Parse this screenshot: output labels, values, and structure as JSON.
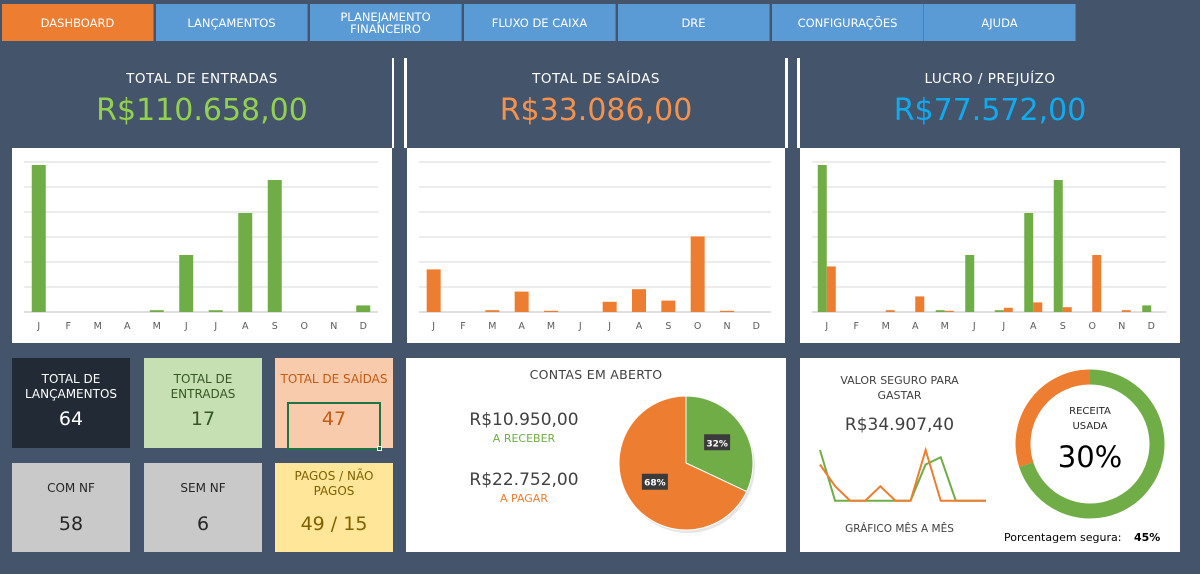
{
  "tabs": [
    {
      "label": "DASHBOARD",
      "active": true
    },
    {
      "label": "LANÇAMENTOS"
    },
    {
      "label": "PLANEJAMENTO FINANCEIRO"
    },
    {
      "label": "FLUXO DE CAIXA"
    },
    {
      "label": "DRE"
    },
    {
      "label": "CONFIGURAÇÕES"
    },
    {
      "label": "AJUDA"
    }
  ],
  "entradas": {
    "title": "TOTAL DE ENTRADAS",
    "value": "R$110.658,00",
    "color": "#92d050"
  },
  "saidas": {
    "title": "TOTAL DE SAÍDAS",
    "value": "R$33.086,00",
    "color": "#ed7d31"
  },
  "lucro": {
    "title": "LUCRO / PREJUÍZO",
    "value": "R$77.572,00",
    "color": "#00b0f0"
  },
  "kpis": {
    "lancamentos": {
      "title": "TOTAL DE LANÇAMENTOS",
      "value": "64"
    },
    "entradas": {
      "title": "TOTAL DE ENTRADAS",
      "value": "17"
    },
    "saidas": {
      "title": "TOTAL DE SAÍDAS",
      "value": "47"
    },
    "com_nf": {
      "title": "COM NF",
      "value": "58"
    },
    "sem_nf": {
      "title": "SEM NF",
      "value": "6"
    },
    "pagos": {
      "title": "PAGOS / NÃO PAGOS",
      "value": "49 / 15"
    }
  },
  "contas": {
    "title": "CONTAS EM ABERTO",
    "receber_value": "R$10.950,00",
    "receber_label": "A RECEBER",
    "pagar_value": "R$22.752,00",
    "pagar_label": "A PAGAR"
  },
  "seguro": {
    "title": "VALOR SEGURO PARA GASTAR",
    "value": "R$34.907,40",
    "chart_label": "GRÁFICO MÊS A MÊS",
    "donut_title": "RECEITA USADA",
    "donut_value": "30%",
    "porcentagem_label": "Porcentagem segura:",
    "porcentagem_value": "45%"
  },
  "chart_data": [
    {
      "type": "bar",
      "categories": [
        "J",
        "F",
        "M",
        "A",
        "M",
        "J",
        "J",
        "A",
        "S",
        "O",
        "N",
        "D"
      ],
      "series": [
        {
          "values": [
            24500,
            0,
            0,
            0,
            300,
            9500,
            300,
            16500,
            22000,
            0,
            0,
            1100
          ]
        }
      ],
      "colors": [
        "#70ad47"
      ],
      "grid": true
    },
    {
      "type": "bar",
      "categories": [
        "J",
        "F",
        "M",
        "A",
        "M",
        "J",
        "J",
        "A",
        "S",
        "O",
        "N",
        "D"
      ],
      "series": [
        {
          "values": [
            7100,
            0,
            300,
            3400,
            200,
            0,
            1700,
            3800,
            1900,
            12600,
            200,
            0
          ]
        }
      ],
      "colors": [
        "#ed7d31"
      ],
      "grid": true
    },
    {
      "type": "bar",
      "categories": [
        "J",
        "F",
        "M",
        "A",
        "M",
        "J",
        "J",
        "A",
        "S",
        "O",
        "N",
        "D"
      ],
      "series": [
        {
          "values": [
            24500,
            0,
            0,
            0,
            300,
            9500,
            300,
            16500,
            22000,
            0,
            0,
            1100
          ]
        },
        {
          "values": [
            7600,
            0,
            300,
            2600,
            200,
            0,
            700,
            1600,
            800,
            9500,
            300,
            0
          ]
        }
      ],
      "colors": [
        "#70ad47",
        "#ed7d31"
      ],
      "grid": true
    },
    {
      "type": "pie",
      "categories": [
        "A RECEBER",
        "A PAGAR"
      ],
      "values": [
        32,
        68
      ],
      "labels": [
        "32%",
        "68%"
      ],
      "colors": [
        "#70ad47",
        "#ed7d31"
      ]
    },
    {
      "type": "line",
      "series": [
        {
          "values": [
            8,
            1,
            1,
            1,
            1,
            1,
            1,
            6,
            7,
            1,
            1,
            1
          ]
        },
        {
          "values": [
            6,
            3,
            1,
            1,
            3,
            1,
            1,
            8,
            1,
            1,
            1,
            1
          ]
        }
      ],
      "colors": [
        "#70ad47",
        "#ed7d31"
      ]
    },
    {
      "type": "pie",
      "categories": [
        "RECEITA USADA",
        "RESTANTE"
      ],
      "values": [
        30,
        70
      ],
      "colors": [
        "#ed7d31",
        "#70ad47"
      ]
    }
  ]
}
